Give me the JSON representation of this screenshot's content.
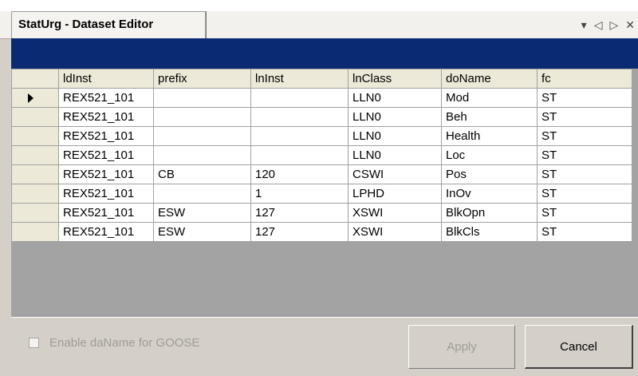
{
  "window": {
    "tab_title": "StatUrg - Dataset Editor",
    "controls": {
      "dropdown": "▾",
      "prev": "◁",
      "next": "▷",
      "close": "✕"
    }
  },
  "grid": {
    "columns": [
      "ldInst",
      "prefix",
      "lnInst",
      "lnClass",
      "doName",
      "fc"
    ],
    "current_row_index": 0,
    "rows": [
      [
        "REX521_101",
        "",
        "",
        "LLN0",
        "Mod",
        "ST"
      ],
      [
        "REX521_101",
        "",
        "",
        "LLN0",
        "Beh",
        "ST"
      ],
      [
        "REX521_101",
        "",
        "",
        "LLN0",
        "Health",
        "ST"
      ],
      [
        "REX521_101",
        "",
        "",
        "LLN0",
        "Loc",
        "ST"
      ],
      [
        "REX521_101",
        "CB",
        "120",
        "CSWI",
        "Pos",
        "ST"
      ],
      [
        "REX521_101",
        "",
        "1",
        "LPHD",
        "InOv",
        "ST"
      ],
      [
        "REX521_101",
        "ESW",
        "127",
        "XSWI",
        "BlkOpn",
        "ST"
      ],
      [
        "REX521_101",
        "ESW",
        "127",
        "XSWI",
        "BlkCls",
        "ST"
      ]
    ]
  },
  "footer": {
    "checkbox_label": "Enable daName for GOOSE",
    "checkbox_checked": false,
    "apply_label": "Apply",
    "cancel_label": "Cancel"
  },
  "colors": {
    "title_strip": "#0a2b74",
    "grid_background": "#a3a3a3",
    "dialog_background": "#d4d0c8"
  }
}
